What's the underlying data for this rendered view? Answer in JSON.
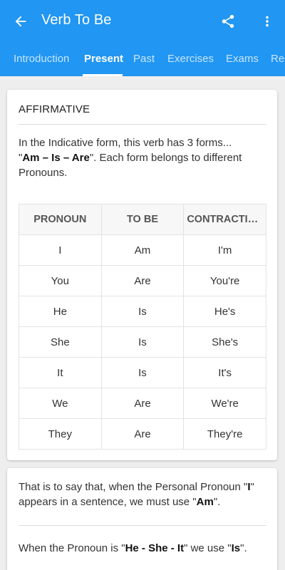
{
  "toolbar": {
    "title": "Verb To Be",
    "back_icon": "arrow-back-icon",
    "share_icon": "share-icon",
    "more_icon": "more-vert-icon"
  },
  "tabs": [
    {
      "label": "Introduction"
    },
    {
      "label": "Present",
      "active": true
    },
    {
      "label": "Past"
    },
    {
      "label": "Exercises"
    },
    {
      "label": "Exams"
    },
    {
      "label": "Res"
    }
  ],
  "card1": {
    "title": "AFFIRMATIVE",
    "intro_line1": "In the Indicative form, this verb has 3 forms...",
    "intro_forms": "Am – Is – Are",
    "intro_line2_rest": ". Each form belongs to different Pronouns.",
    "table": {
      "headers": [
        "PRONOUN",
        "TO BE",
        "CONTRACTION"
      ],
      "rows": [
        [
          "I",
          "Am",
          "I'm"
        ],
        [
          "You",
          "Are",
          "You're"
        ],
        [
          "He",
          "Is",
          "He's"
        ],
        [
          "She",
          "Is",
          "She's"
        ],
        [
          "It",
          "Is",
          "It's"
        ],
        [
          "We",
          "Are",
          "We're"
        ],
        [
          "They",
          "Are",
          "They're"
        ]
      ]
    }
  },
  "card2": {
    "p1_a": "That is to say that, when the Personal Pronoun \"",
    "p1_b": "I",
    "p1_c": "\" appears in a sentence, we must use \"",
    "p1_d": "Am",
    "p1_e": "\".",
    "p2_a": "When the Pronoun is \"",
    "p2_b": "He - She - It",
    "p2_c": "\" we use \"",
    "p2_d": "Is",
    "p2_e": "\"."
  },
  "colors": {
    "primary": "#2196f3",
    "background": "#eeeeee"
  }
}
